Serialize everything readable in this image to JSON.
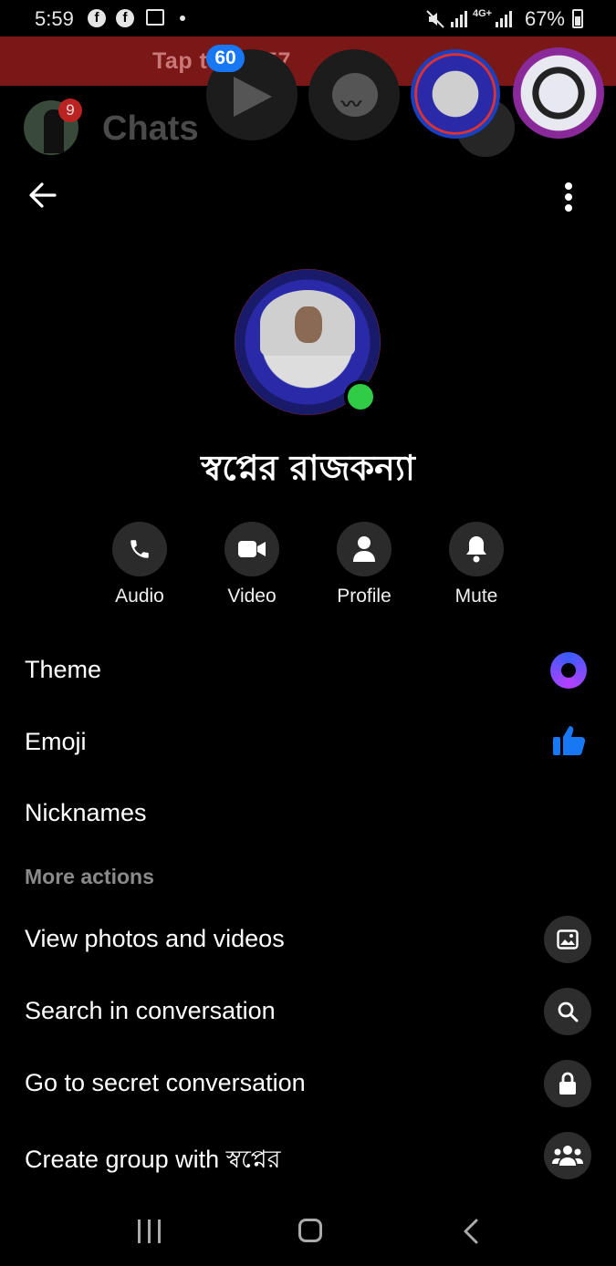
{
  "status_bar": {
    "time": "5:59",
    "battery": "67%",
    "network": "4G+"
  },
  "background": {
    "banner_text": "Tap t    to    1:57",
    "chats_title": "Chats",
    "chats_badge": "9",
    "chathead_count": "60"
  },
  "header": {
    "back_icon": "arrow-left-icon",
    "more_icon": "more-vertical-icon"
  },
  "profile": {
    "name": "স্বপ্নের রাজকন্যা",
    "online": true
  },
  "actions": [
    {
      "label": "Audio",
      "icon": "phone-icon"
    },
    {
      "label": "Video",
      "icon": "video-camera-icon"
    },
    {
      "label": "Profile",
      "icon": "person-icon"
    },
    {
      "label": "Mute",
      "icon": "bell-icon"
    }
  ],
  "menu": {
    "theme": "Theme",
    "emoji": "Emoji",
    "nicknames": "Nicknames",
    "more_actions_header": "More actions",
    "view_media": "View photos and videos",
    "search": "Search in conversation",
    "secret": "Go to secret conversation",
    "create_group": "Create group with স্বপ্নের"
  },
  "colors": {
    "accent": "#1877f2",
    "online": "#31cc46",
    "banner": "#7a1818"
  }
}
